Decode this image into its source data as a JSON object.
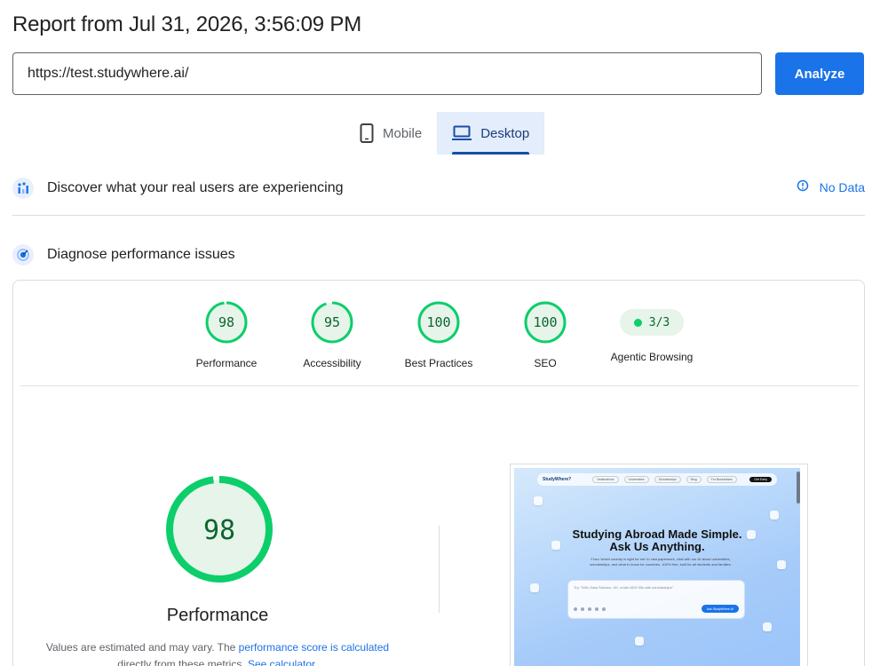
{
  "report": {
    "title": "Report from Jul 31, 2026, 3:56:09 PM"
  },
  "url_bar": {
    "value": "https://test.studywhere.ai/",
    "analyze_label": "Analyze"
  },
  "tabs": [
    {
      "label": "Mobile",
      "icon": "phone-icon",
      "active": false
    },
    {
      "label": "Desktop",
      "icon": "laptop-icon",
      "active": true
    }
  ],
  "field_data": {
    "label": "Discover what your real users are experiencing",
    "status": "No Data",
    "icon": "users-chart-icon",
    "status_icon": "info-icon"
  },
  "lab_data": {
    "label": "Diagnose performance issues",
    "icon": "gauge-icon"
  },
  "scores": [
    {
      "label": "Performance",
      "value": "98",
      "fraction": 0.98
    },
    {
      "label": "Accessibility",
      "value": "95",
      "fraction": 0.95
    },
    {
      "label": "Best Practices",
      "value": "100",
      "fraction": 1.0
    },
    {
      "label": "SEO",
      "value": "100",
      "fraction": 1.0
    }
  ],
  "agentic": {
    "label": "Agentic Browsing",
    "value": "3/3"
  },
  "performance": {
    "score": "98",
    "fraction": 0.98,
    "title": "Performance",
    "note_prefix": "Values are estimated and may vary. The ",
    "note_link": "performance score is calculated",
    "note_mid": " directly from these metrics. ",
    "note_link2": "See calculator."
  },
  "screenshot": {
    "logo": "StudyWhere?",
    "nav_links": [
      "Destinations",
      "Universities",
      "Scholarships",
      "Blog",
      "For Businesses"
    ],
    "nav_cta": "Get Early",
    "headline_1": "Studying Abroad Made Simple.",
    "headline_2": "Ask Us Anything.",
    "subtext": "From 'which country is right for me' to visa paperwork, chat with our AI about universities, scholarships, and what to know for countries. 100% free, built for all students and families.",
    "search_placeholder": "Try: \"MSc Data Science, UK, under AED 90k with scholarships\"",
    "search_button": "Ask StudyWhere AI"
  },
  "colors": {
    "accent": "#1a73e8",
    "pass": "#0cce6b",
    "pass_text": "#0d652d",
    "pass_fill": "#e6f4ea"
  }
}
